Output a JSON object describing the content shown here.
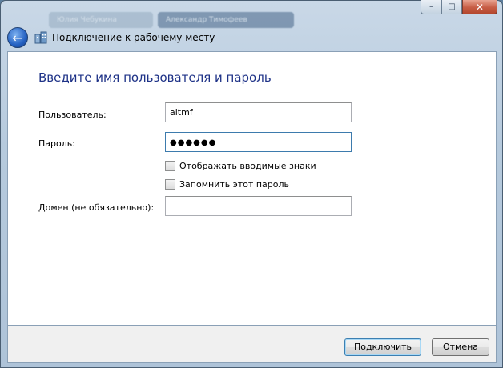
{
  "window": {
    "background_tabs": [
      "Юлия Чебукина",
      "Александр Тимофеев"
    ],
    "caption": {
      "min_glyph": "–",
      "max_glyph": "□",
      "close_glyph": "✕"
    }
  },
  "nav": {
    "back_glyph": "←",
    "title": "Подключение к рабочему месту"
  },
  "form": {
    "heading": "Введите имя пользователя и пароль",
    "username_label": "Пользователь:",
    "username_value": "altmf",
    "password_label": "Пароль:",
    "password_mask": "●●●●●●",
    "show_chars_label": "Отображать вводимые знаки",
    "remember_label": "Запомнить этот пароль",
    "domain_label": "Домен (не обязательно):",
    "domain_value": ""
  },
  "buttons": {
    "connect": "Подключить",
    "cancel": "Отмена"
  },
  "colors": {
    "heading": "#1e3287",
    "focus_border": "#3d7bad",
    "close": "#c75d45"
  }
}
